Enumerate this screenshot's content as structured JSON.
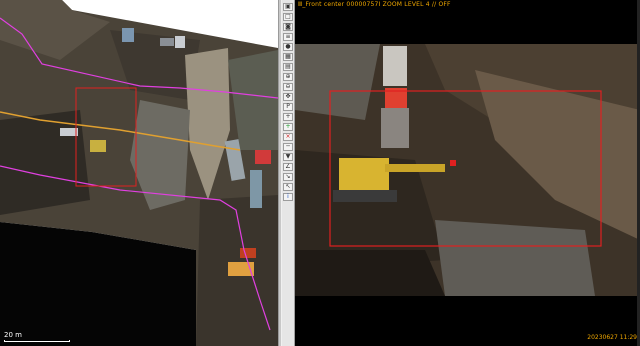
{
  "left_map": {
    "scale_label": "20 m"
  },
  "toolbar": {
    "buttons": [
      {
        "icon": "save-icon",
        "glyph": "▣"
      },
      {
        "icon": "window-icon",
        "glyph": "□"
      },
      {
        "icon": "camera-icon",
        "glyph": "◙"
      },
      {
        "icon": "list-icon",
        "glyph": "≡"
      },
      {
        "icon": "record-icon",
        "glyph": "●"
      },
      {
        "icon": "grid-icon",
        "glyph": "▦"
      },
      {
        "icon": "image-icon",
        "glyph": "▤"
      },
      {
        "icon": "zoom-in-icon",
        "glyph": "⊕"
      },
      {
        "icon": "zoom-out-icon",
        "glyph": "⊖"
      },
      {
        "icon": "pan-icon",
        "glyph": "✥"
      },
      {
        "icon": "print-icon",
        "glyph": "P"
      },
      {
        "icon": "plus-icon",
        "glyph": "+"
      },
      {
        "icon": "add-green-icon",
        "glyph": "+"
      },
      {
        "icon": "close-red-icon",
        "glyph": "×"
      },
      {
        "icon": "line-icon",
        "glyph": "─"
      },
      {
        "icon": "marker-icon",
        "glyph": "▼"
      },
      {
        "icon": "angle-icon",
        "glyph": "∠"
      },
      {
        "icon": "measure-icon",
        "glyph": "↘"
      },
      {
        "icon": "pointer-icon",
        "glyph": "↖"
      },
      {
        "icon": "info-icon",
        "glyph": "i"
      }
    ]
  },
  "viewer": {
    "info_text": "Ⅲ_Front center 00000757I   ZOOM LEVEL 4 // OFF",
    "date_text": "20230627 11:29"
  },
  "colors": {
    "overlay_box": "#e02020",
    "route_line": "#e040e0",
    "pipe_line": "#e0a030",
    "annotation_text": "#f2a900"
  }
}
